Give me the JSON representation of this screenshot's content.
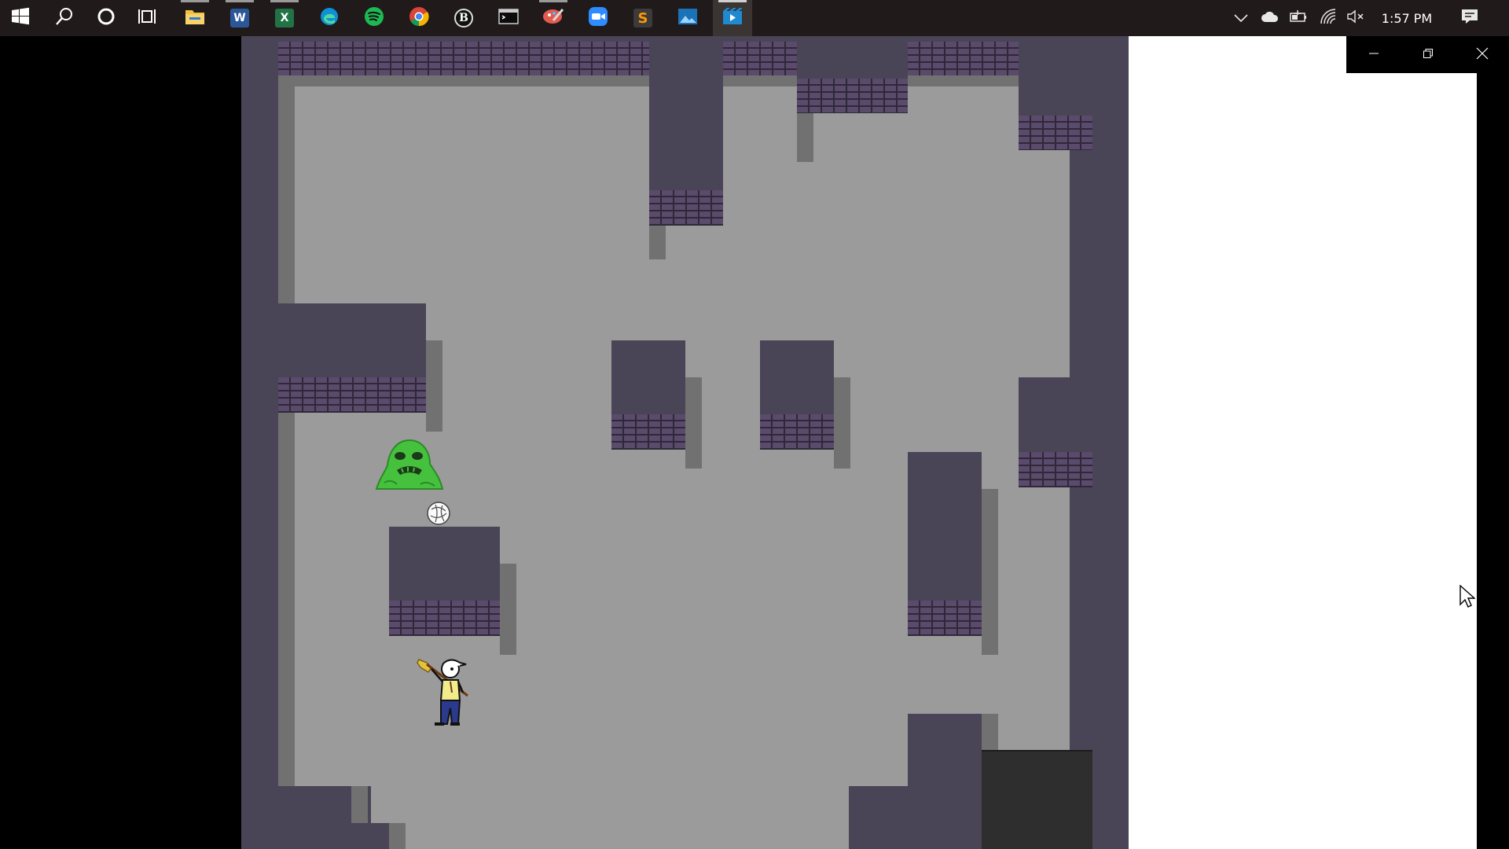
{
  "taskbar": {
    "apps": [
      {
        "name": "start-icon"
      },
      {
        "name": "search-icon"
      },
      {
        "name": "cortana-icon"
      },
      {
        "name": "task-view-icon"
      },
      {
        "name": "file-explorer-icon",
        "open": true
      },
      {
        "name": "word-icon",
        "letter": "W",
        "color": "#2b579a",
        "open": true
      },
      {
        "name": "excel-icon",
        "letter": "X",
        "color": "#217346",
        "open": true
      },
      {
        "name": "edge-icon",
        "color": "#0f8fd6"
      },
      {
        "name": "spotify-icon",
        "color": "#1db954"
      },
      {
        "name": "chrome-icon"
      },
      {
        "name": "app-b-icon",
        "letter": "B"
      },
      {
        "name": "terminal-icon"
      },
      {
        "name": "paint-icon",
        "open": true
      },
      {
        "name": "zoom-icon",
        "color": "#2d8cff"
      },
      {
        "name": "sublime-icon",
        "letter": "S",
        "color": "#ff9800"
      },
      {
        "name": "photos-icon",
        "color": "#1a73b8"
      },
      {
        "name": "movies-tv-icon",
        "color": "#1f8ad2",
        "active": true
      }
    ],
    "tray": {
      "icons": [
        "chevron-up-icon",
        "onedrive-icon",
        "battery-icon",
        "wifi-icon",
        "volume-muted-icon"
      ],
      "time": "1:57 PM",
      "notification_icon": "notification-icon"
    }
  },
  "window": {
    "controls": [
      "minimize-icon",
      "restore-icon",
      "close-icon"
    ]
  },
  "game": {
    "colors": {
      "wall": "#4a4457",
      "floor": "#9b9b9b",
      "shadow": "#717171",
      "brick": "#5a4a6b",
      "slime": "#45c13e",
      "exit": "#2e2e2e"
    },
    "sprites": [
      "player-character",
      "green-slime-enemy",
      "spinning-orb-projectile",
      "mouse-cursor-icon"
    ]
  }
}
